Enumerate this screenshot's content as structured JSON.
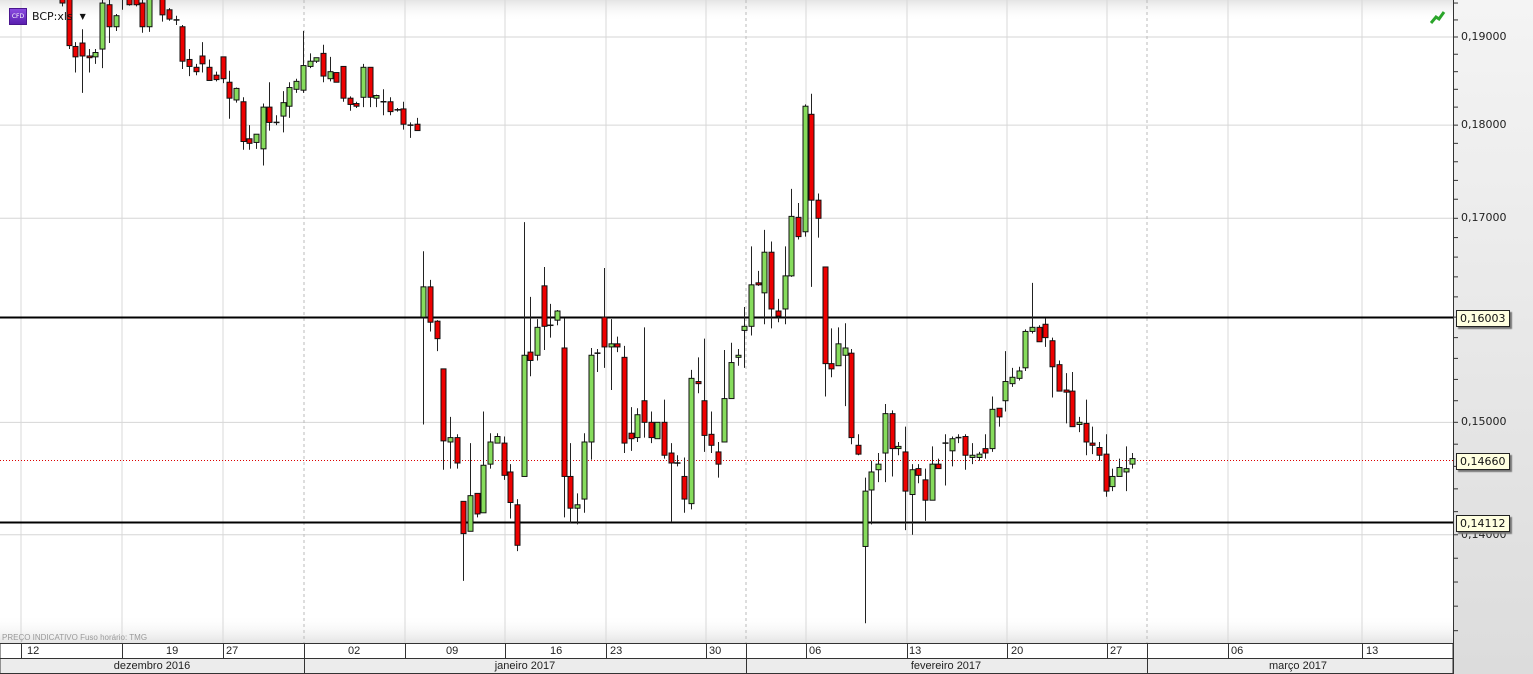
{
  "header": {
    "badge": "CFD",
    "symbol": "BCP:xls"
  },
  "footer": {
    "note": "PREÇO INDICATIVO   Fuso horário: TMG"
  },
  "colors": {
    "up": "#86dc5c",
    "down": "#ee0000",
    "line": "#000000",
    "last": "#dd0000"
  },
  "chart_data": {
    "type": "candlestick",
    "title": "BCP:xls",
    "scale": "log",
    "ylim": [
      0.131,
      0.1944
    ],
    "grid": true,
    "yticks": [
      {
        "value": 0.19,
        "label": "0,19000"
      },
      {
        "value": 0.18,
        "label": "0,18000"
      },
      {
        "value": 0.17,
        "label": "0,17000"
      },
      {
        "value": 0.15,
        "label": "0,15000"
      },
      {
        "value": 0.14,
        "label": "0,14000"
      }
    ],
    "levels": [
      {
        "value": 0.16003,
        "label": "0,16003",
        "style": "solid"
      },
      {
        "value": 0.14112,
        "label": "0,14112",
        "style": "solid"
      },
      {
        "value": 0.1466,
        "label": "0,14660",
        "style": "dotted-last"
      }
    ],
    "x_days": [
      "12",
      "19",
      "27",
      "02",
      "09",
      "16",
      "23",
      "30",
      "06",
      "13",
      "20",
      "27",
      "06",
      "13"
    ],
    "x_months": [
      "dezembro 2016",
      "janeiro 2017",
      "fevereiro 2017",
      "março 2017"
    ],
    "ohlc_fields": [
      "open",
      "high",
      "low",
      "close"
    ],
    "candles": [
      [
        0.1948,
        0.1952,
        0.1936,
        0.194
      ],
      [
        0.195,
        0.1955,
        0.1886,
        0.189
      ],
      [
        0.1889,
        0.1894,
        0.1859,
        0.1877
      ],
      [
        0.1893,
        0.1909,
        0.1836,
        0.1878
      ],
      [
        0.1878,
        0.1886,
        0.1859,
        0.1876
      ],
      [
        0.1877,
        0.1886,
        0.1869,
        0.1882
      ],
      [
        0.1886,
        0.1944,
        0.1864,
        0.194
      ],
      [
        0.1938,
        0.1944,
        0.1893,
        0.1912
      ],
      [
        0.1912,
        0.1927,
        0.1907,
        0.1925
      ],
      [
        0.196,
        0.1965,
        0.1932,
        0.195
      ],
      [
        0.195,
        0.1955,
        0.1937,
        0.1938
      ],
      [
        0.1948,
        0.1952,
        0.1936,
        0.1938
      ],
      [
        0.194,
        0.195,
        0.1905,
        0.1912
      ],
      [
        0.1912,
        0.1955,
        0.1906,
        0.195
      ],
      null,
      [
        0.195,
        0.1955,
        0.1918,
        0.1926
      ],
      [
        0.1932,
        0.1934,
        0.1919,
        0.1921
      ],
      [
        0.192,
        0.1925,
        0.1914,
        0.192
      ],
      [
        0.1912,
        0.1914,
        0.1863,
        0.1872
      ],
      [
        0.1874,
        0.1886,
        0.1855,
        0.1866
      ],
      [
        0.1865,
        0.1869,
        0.1856,
        0.186
      ],
      [
        0.1878,
        0.1894,
        0.1859,
        0.1869
      ],
      [
        0.1865,
        0.1874,
        0.185,
        0.185
      ],
      [
        0.1856,
        0.186,
        0.1849,
        0.1851
      ],
      [
        0.1877,
        0.1877,
        0.1847,
        0.1852
      ],
      [
        0.1848,
        0.1861,
        0.1807,
        0.183
      ],
      [
        0.1828,
        0.1842,
        0.1825,
        0.1841
      ],
      [
        0.1826,
        0.1831,
        0.1773,
        0.1782
      ],
      [
        0.1785,
        0.18,
        0.1773,
        0.178
      ],
      [
        0.1781,
        0.179,
        0.1774,
        0.179
      ],
      [
        0.1774,
        0.1824,
        0.1756,
        0.182
      ],
      [
        0.182,
        0.1848,
        0.1794,
        0.1803
      ],
      [
        0.1803,
        0.1811,
        0.18,
        0.1803
      ],
      [
        0.181,
        0.1838,
        0.1792,
        0.1825
      ],
      [
        0.1821,
        0.1848,
        0.1808,
        0.1842
      ],
      [
        0.184,
        0.1852,
        0.1836,
        0.1849
      ],
      [
        0.1839,
        0.1907,
        0.1836,
        0.1867
      ],
      [
        0.1866,
        0.1881,
        0.1864,
        0.1872
      ],
      [
        0.1872,
        0.1876,
        0.187,
        0.1876
      ],
      [
        0.1881,
        0.1891,
        0.1848,
        0.1855
      ],
      [
        0.1852,
        0.1877,
        0.1849,
        0.186
      ],
      [
        0.1859,
        0.1859,
        0.1848,
        0.1848
      ],
      [
        0.1866,
        0.1866,
        0.1826,
        0.183
      ],
      [
        0.183,
        0.1832,
        0.1816,
        0.1823
      ],
      [
        0.1824,
        0.1826,
        0.1819,
        0.1821
      ],
      [
        0.1831,
        0.1869,
        0.182,
        0.1865
      ],
      [
        0.1865,
        0.1865,
        0.182,
        0.1831
      ],
      [
        0.183,
        0.1834,
        0.182,
        0.1833
      ],
      [
        0.1826,
        0.184,
        0.1811,
        0.1826
      ],
      [
        0.1826,
        0.1831,
        0.1811,
        0.1815
      ],
      [
        0.1817,
        0.1819,
        0.1815,
        0.1817
      ],
      [
        0.1818,
        0.1826,
        0.1795,
        0.1801
      ],
      [
        0.18,
        0.1803,
        0.1786,
        0.18
      ],
      [
        0.1801,
        0.1808,
        0.1794,
        0.1794
      ],
      [
        0.16,
        0.1666,
        0.1498,
        0.163
      ],
      [
        0.163,
        0.1637,
        0.1586,
        0.1595
      ],
      [
        0.1596,
        0.1597,
        0.1567,
        0.1579
      ],
      [
        0.155,
        0.155,
        0.1457,
        0.1483
      ],
      [
        0.1482,
        0.1505,
        0.1458,
        0.1486
      ],
      [
        0.1486,
        0.1489,
        0.1458,
        0.1463
      ],
      [
        0.1429,
        0.1429,
        0.1361,
        0.1401
      ],
      [
        0.1403,
        0.1481,
        0.1403,
        0.1434
      ],
      [
        0.1436,
        0.1436,
        0.1415,
        0.1418
      ],
      [
        0.1419,
        0.151,
        0.1419,
        0.1461
      ],
      [
        0.1462,
        0.149,
        0.1458,
        0.1482
      ],
      [
        0.1481,
        0.149,
        0.1481,
        0.1487
      ],
      [
        0.1481,
        0.1487,
        0.1448,
        0.1452
      ],
      [
        0.1455,
        0.1462,
        0.1414,
        0.1428
      ],
      [
        0.1426,
        0.1431,
        0.1386,
        0.1391
      ],
      [
        0.1451,
        0.1696,
        0.1451,
        0.1563
      ],
      [
        0.1566,
        0.162,
        0.1543,
        0.1558
      ],
      [
        0.1563,
        0.1598,
        0.1558,
        0.159
      ],
      [
        0.1631,
        0.165,
        0.1568,
        0.1591
      ],
      [
        0.1592,
        0.1613,
        0.158,
        0.1592
      ],
      [
        0.1597,
        0.1607,
        0.1592,
        0.1606
      ],
      [
        0.157,
        0.1599,
        0.1415,
        0.1451
      ],
      [
        0.1451,
        0.1481,
        0.141,
        0.1423
      ],
      [
        0.1423,
        0.1436,
        0.1409,
        0.1426
      ],
      [
        0.1431,
        0.149,
        0.1419,
        0.1482
      ],
      [
        0.1482,
        0.157,
        0.1466,
        0.1563
      ],
      [
        0.1565,
        0.1569,
        0.1547,
        0.1565
      ],
      [
        0.16,
        0.1649,
        0.1551,
        0.1571
      ],
      [
        0.1571,
        0.1598,
        0.153,
        0.1574
      ],
      [
        0.1574,
        0.1581,
        0.1566,
        0.1571
      ],
      [
        0.1561,
        0.1572,
        0.1472,
        0.1481
      ],
      [
        0.149,
        0.1514,
        0.1474,
        0.1485
      ],
      [
        0.1486,
        0.1513,
        0.1482,
        0.1507
      ],
      [
        0.152,
        0.159,
        0.1486,
        0.15
      ],
      [
        0.15,
        0.151,
        0.1481,
        0.1486
      ],
      [
        0.1485,
        0.15,
        0.1485,
        0.15
      ],
      [
        0.15,
        0.1521,
        0.1467,
        0.147
      ],
      [
        0.1472,
        0.1481,
        0.1411,
        0.1463
      ],
      [
        0.1463,
        0.147,
        0.146,
        0.1463
      ],
      [
        0.1451,
        0.1468,
        0.1419,
        0.1431
      ],
      [
        0.1427,
        0.1549,
        0.1422,
        0.1541
      ],
      [
        0.1538,
        0.1561,
        0.1527,
        0.1536
      ],
      [
        0.152,
        0.1579,
        0.1473,
        0.1488
      ],
      [
        0.1489,
        0.151,
        0.1472,
        0.1479
      ],
      [
        0.1473,
        0.1482,
        0.145,
        0.1462
      ],
      [
        0.1482,
        0.1568,
        0.1482,
        0.1522
      ],
      [
        0.1522,
        0.1575,
        0.1522,
        0.1556
      ],
      [
        0.1561,
        0.1569,
        0.1553,
        0.1563
      ],
      [
        0.1587,
        0.161,
        0.1551,
        0.1591
      ],
      [
        0.1591,
        0.1671,
        0.1582,
        0.1632
      ],
      [
        0.1634,
        0.1646,
        0.1631,
        0.1632
      ],
      [
        0.1624,
        0.1688,
        0.1593,
        0.1665
      ],
      [
        0.1665,
        0.1676,
        0.1589,
        0.1608
      ],
      [
        0.1606,
        0.1618,
        0.1595,
        0.1601
      ],
      [
        0.1608,
        0.1671,
        0.1593,
        0.1641
      ],
      [
        0.1641,
        0.1731,
        0.164,
        0.1702
      ],
      [
        0.1701,
        0.1716,
        0.1678,
        0.1681
      ],
      [
        0.1686,
        0.1823,
        0.1681,
        0.1821
      ],
      [
        0.1812,
        0.1835,
        0.163,
        0.1719
      ],
      [
        0.1719,
        0.1726,
        0.168,
        0.17
      ],
      [
        0.165,
        0.165,
        0.1524,
        0.1555
      ],
      [
        0.1555,
        0.1589,
        0.1542,
        0.155
      ],
      [
        0.1553,
        0.159,
        0.1553,
        0.1574
      ],
      [
        0.1563,
        0.1594,
        0.1515,
        0.157
      ],
      [
        0.1565,
        0.1569,
        0.148,
        0.1486
      ],
      [
        0.1479,
        0.1489,
        0.147,
        0.1471
      ],
      [
        0.139,
        0.145,
        0.1326,
        0.1438
      ],
      [
        0.1439,
        0.1465,
        0.1409,
        0.1455
      ],
      [
        0.1457,
        0.1472,
        0.1446,
        0.1462
      ],
      [
        0.1472,
        0.1517,
        0.1446,
        0.1508
      ],
      [
        0.1508,
        0.1511,
        0.1451,
        0.1476
      ],
      [
        0.1476,
        0.1482,
        0.147,
        0.1478
      ],
      [
        0.1473,
        0.1496,
        0.1404,
        0.1438
      ],
      [
        0.1435,
        0.1462,
        0.14,
        0.1457
      ],
      [
        0.1458,
        0.1462,
        0.1445,
        0.1452
      ],
      [
        0.1448,
        0.1458,
        0.1412,
        0.143
      ],
      [
        0.143,
        0.1478,
        0.143,
        0.1462
      ],
      [
        0.1462,
        0.1467,
        0.1458,
        0.1458
      ],
      [
        0.1481,
        0.1489,
        0.1443,
        0.1481
      ],
      [
        0.1474,
        0.1487,
        0.146,
        0.1485
      ],
      [
        0.1486,
        0.1489,
        0.1481,
        0.1486
      ],
      [
        0.1487,
        0.1489,
        0.1457,
        0.147
      ],
      [
        0.1468,
        0.1481,
        0.1462,
        0.147
      ],
      [
        0.1468,
        0.1473,
        0.1465,
        0.1471
      ],
      [
        0.1476,
        0.1489,
        0.1467,
        0.1472
      ],
      [
        0.1476,
        0.1524,
        0.1473,
        0.1512
      ],
      [
        0.1513,
        0.1513,
        0.1496,
        0.1505
      ],
      [
        0.152,
        0.1567,
        0.151,
        0.1538
      ],
      [
        0.1536,
        0.1551,
        0.1533,
        0.1542
      ],
      [
        0.1541,
        0.1552,
        0.1539,
        0.1548
      ],
      [
        0.1551,
        0.1588,
        0.1548,
        0.1586
      ],
      [
        0.1586,
        0.1634,
        0.1584,
        0.159
      ],
      [
        0.159,
        0.1592,
        0.1576,
        0.1576
      ],
      [
        0.1593,
        0.1599,
        0.1571,
        0.158
      ],
      [
        0.1577,
        0.158,
        0.1523,
        0.1552
      ],
      [
        0.1554,
        0.1558,
        0.1529,
        0.1529
      ],
      [
        0.153,
        0.1546,
        0.1499,
        0.1528
      ],
      [
        0.1529,
        0.1547,
        0.1496,
        0.1496
      ],
      [
        0.1498,
        0.1505,
        0.1491,
        0.15
      ],
      [
        0.1499,
        0.1521,
        0.147,
        0.1482
      ],
      [
        0.1481,
        0.1496,
        0.1471,
        0.1479
      ],
      [
        0.1477,
        0.1482,
        0.1465,
        0.147
      ],
      [
        0.1471,
        0.1489,
        0.1433,
        0.1438
      ],
      [
        0.1442,
        0.1458,
        0.1438,
        0.1451
      ],
      [
        0.1451,
        0.1467,
        0.1451,
        0.1459
      ],
      [
        0.1455,
        0.1478,
        0.1438,
        0.1458
      ],
      [
        0.1462,
        0.1472,
        0.1458,
        0.1467
      ]
    ]
  }
}
